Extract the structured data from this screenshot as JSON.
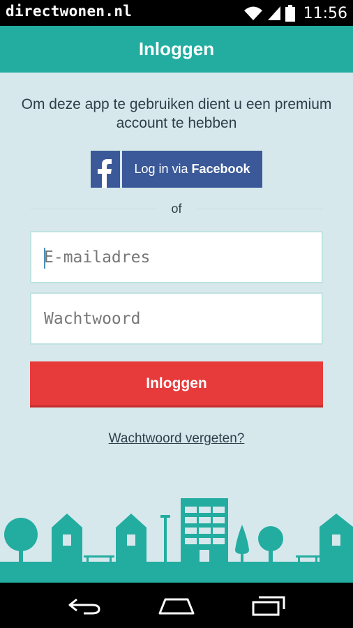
{
  "status_bar": {
    "app_name": "directwonen.nl",
    "time": "11:56",
    "icons": [
      "wifi-icon",
      "signal-icon",
      "battery-icon"
    ]
  },
  "app_bar": {
    "title": "Inloggen"
  },
  "intro_text": "Om deze app te gebruiken dient u een premium account te hebben",
  "facebook_button": {
    "prefix": "Log in",
    "middle": "via",
    "brand": "Facebook",
    "icon": "facebook-icon"
  },
  "divider_text": "of",
  "email_field": {
    "placeholder": "E-mailadres",
    "value": ""
  },
  "password_field": {
    "placeholder": "Wachtwoord",
    "value": ""
  },
  "login_button": {
    "label": "Inloggen"
  },
  "forgot_link": "Wachtwoord vergeten?",
  "nav_bar": {
    "icons": [
      "back-icon",
      "home-icon",
      "recent-apps-icon"
    ]
  },
  "colors": {
    "accent": "#22ada0",
    "background": "#d7e8ec",
    "facebook": "#3b5998",
    "login_button": "#e73a3a",
    "skyline": "#22ada0"
  }
}
